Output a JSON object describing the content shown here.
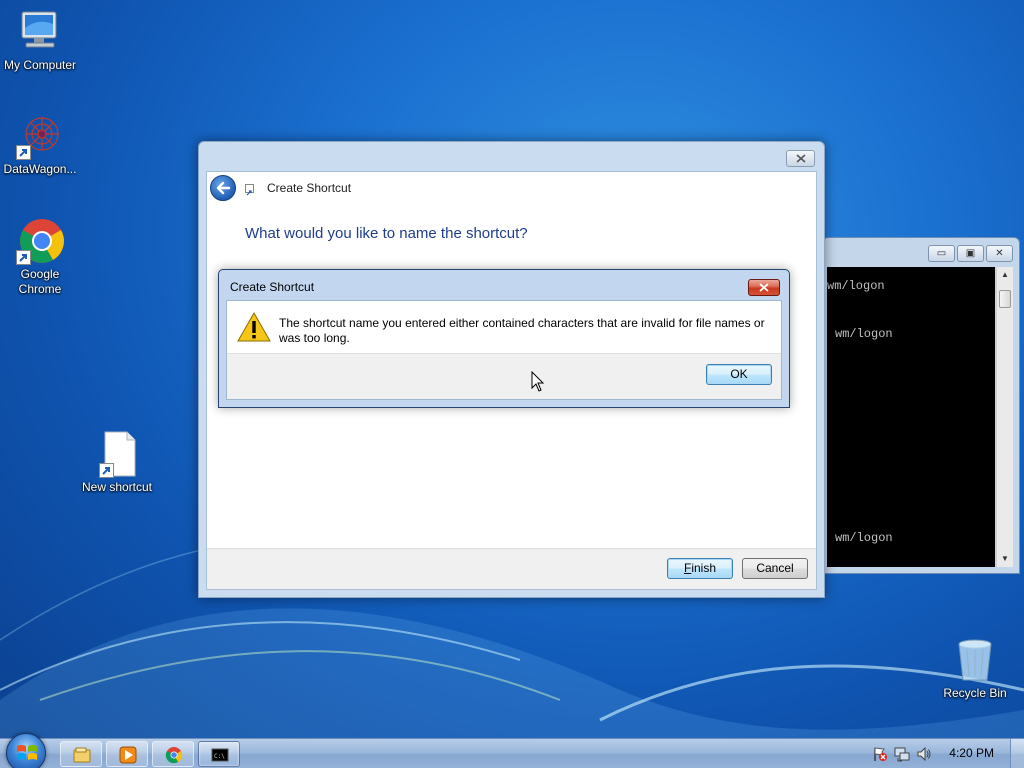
{
  "desktop": {
    "icons": [
      {
        "label": "My Computer"
      },
      {
        "label": "DataWagon..."
      },
      {
        "label": "Google Chrome"
      },
      {
        "label": "New shortcut"
      },
      {
        "label": "Recycle Bin"
      }
    ]
  },
  "console": {
    "lines": [
      "wm/logon",
      "wm/logon",
      "wm/logon"
    ],
    "controls": {
      "minimize": "▭",
      "maximize": "▣",
      "close": "✕"
    }
  },
  "wizard": {
    "title": "Create Shortcut",
    "question": "What would you like to name the shortcut?",
    "finish_prefix": "",
    "finish_underlined": "F",
    "finish_rest": "inish",
    "cancel_label": "Cancel"
  },
  "error_dialog": {
    "title": "Create Shortcut",
    "message": "The shortcut name you entered either contained characters that are invalid for file names or was too long.",
    "ok_label": "OK"
  },
  "taskbar": {
    "clock": "4:20 PM",
    "pinned": [
      "explorer-icon",
      "media-player-icon",
      "chrome-icon",
      "console-icon"
    ],
    "tray": [
      "action-center-flag-icon",
      "network-icon",
      "volume-icon"
    ]
  },
  "colors": {
    "desktop_blue": "#1a6fcf",
    "wizard_heading": "#1e3d8f",
    "close_red": "#c7381d",
    "taskbar": "#9bb8dc"
  }
}
